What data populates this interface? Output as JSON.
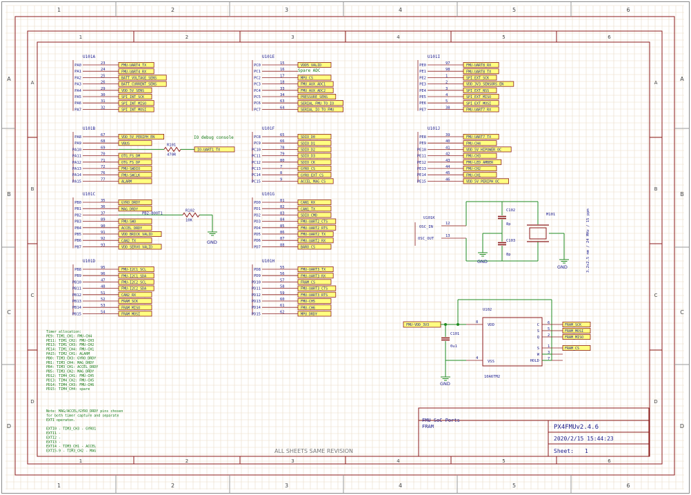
{
  "colors": {
    "border": "#8b1a1a",
    "grid": "#e9dcc6",
    "wire": "#1f8a1f",
    "net_fill": "#ffff80",
    "net_stroke": "#8b1a1a",
    "text_blue": "#1a1a8c",
    "note_green": "#117711"
  },
  "outer_col_labels": [
    "1",
    "2",
    "3",
    "4",
    "5",
    "6"
  ],
  "outer_row_labels": [
    "A",
    "B",
    "C",
    "D"
  ],
  "inner_col_labels": [
    "1",
    "2",
    "3",
    "4",
    "5",
    "6"
  ],
  "inner_row_labels": [
    "A",
    "B",
    "C",
    "D"
  ],
  "blocks": [
    {
      "id": "U101A",
      "pins": [
        {
          "name": "PA0",
          "num": "23",
          "net": "FMU-UART4_TX"
        },
        {
          "name": "PA1",
          "num": "24",
          "net": "FMU-UART4_RX"
        },
        {
          "name": "PA2",
          "num": "25",
          "net": "BATT_VOLTAGE_SENS"
        },
        {
          "name": "PA3",
          "num": "26",
          "net": "BATT_CURRENT_SENS"
        },
        {
          "name": "PA4",
          "num": "29",
          "net": "VDD_5V_SENS"
        },
        {
          "name": "PA5",
          "num": "30",
          "net": "SPI_INT_SCK"
        },
        {
          "name": "PA6",
          "num": "31",
          "net": "SPI_INT_MISO"
        },
        {
          "name": "PA7",
          "num": "32",
          "net": "SPI_INT_MOSI"
        }
      ]
    },
    {
      "id": "U101B",
      "pins": [
        {
          "name": "PA8",
          "num": "67",
          "net": "VDD_5V_PERIPH_EN"
        },
        {
          "name": "PA9",
          "num": "68",
          "net": "VBUS"
        },
        {
          "name": "PA10",
          "num": "69",
          "net": ""
        },
        {
          "name": "PA11",
          "num": "70",
          "net": "OTG_FS_DM"
        },
        {
          "name": "PA12",
          "num": "71",
          "net": "OTG_FS_DP"
        },
        {
          "name": "PA13",
          "num": "72",
          "net": "FMU-SWDIO"
        },
        {
          "name": "PA14",
          "num": "76",
          "net": "FMU-SWCLK"
        },
        {
          "name": "PA15",
          "num": "77",
          "net": "ALARM"
        }
      ]
    },
    {
      "id": "U101C",
      "pins": [
        {
          "name": "PB0",
          "num": "35",
          "net": "GYRO_DRDY"
        },
        {
          "name": "PB1",
          "num": "36",
          "net": "MAG_DRDY"
        },
        {
          "name": "PB2",
          "num": "37",
          "net": ""
        },
        {
          "name": "PB3",
          "num": "89",
          "net": "FMU-SWO"
        },
        {
          "name": "PB4",
          "num": "90",
          "net": "ACCEL_DRDY"
        },
        {
          "name": "PB5",
          "num": "91",
          "net": "VDD_BRICK_VALID"
        },
        {
          "name": "PB6",
          "num": "92",
          "net": "CAN2_TX"
        },
        {
          "name": "PB7",
          "num": "93",
          "net": "VDD_SERVO_VALID"
        }
      ]
    },
    {
      "id": "U101D",
      "pins": [
        {
          "name": "PB8",
          "num": "95",
          "net": "FMU-I2C1_SCL"
        },
        {
          "name": "PB9",
          "num": "96",
          "net": "FMU-I2C1_SDA"
        },
        {
          "name": "PB10",
          "num": "47",
          "net": "FMU-I2C2_SCL"
        },
        {
          "name": "PB11",
          "num": "48",
          "net": "FMU-I2C2_SDA"
        },
        {
          "name": "PB12",
          "num": "51",
          "net": "CAN2_RX"
        },
        {
          "name": "PB13",
          "num": "52",
          "net": "FRAM_SCK"
        },
        {
          "name": "PB14",
          "num": "53",
          "net": "FRAM_MISO"
        },
        {
          "name": "PB15",
          "num": "54",
          "net": "FRAM_MOSI"
        }
      ]
    },
    {
      "id": "U101E",
      "pins": [
        {
          "name": "PC0",
          "num": "15",
          "net": "VDD5_VALID"
        },
        {
          "name": "PC1",
          "num": "16",
          "net": ""
        },
        {
          "name": "PC2",
          "num": "17",
          "net": "MPU_CS"
        },
        {
          "name": "PC3",
          "num": "18",
          "net": "FMU_AUX_ADC1"
        },
        {
          "name": "PC4",
          "num": "33",
          "net": "FMU_AUX_ADC2"
        },
        {
          "name": "PC5",
          "num": "34",
          "net": "PRESSURE_SENS"
        },
        {
          "name": "PC6",
          "num": "63",
          "net": "SERIAL_FMU_TO_IO"
        },
        {
          "name": "PC7",
          "num": "64",
          "net": "SERIAL_IO_TO_FMU"
        }
      ]
    },
    {
      "id": "U101F",
      "pins": [
        {
          "name": "PC8",
          "num": "65",
          "net": "SDIO_D0"
        },
        {
          "name": "PC9",
          "num": "66",
          "net": "SDIO_D1"
        },
        {
          "name": "PC10",
          "num": "78",
          "net": "SDIO_D2"
        },
        {
          "name": "PC11",
          "num": "79",
          "net": "SDIO_D3"
        },
        {
          "name": "PC12",
          "num": "80",
          "net": "SDIO_CK"
        },
        {
          "name": "PC13",
          "num": "7",
          "net": "GYRO_CS"
        },
        {
          "name": "PC14",
          "num": "8",
          "net": "GYRO_EXT_CS"
        },
        {
          "name": "PC15",
          "num": "9",
          "net": "ACCEL_MAG_CS"
        }
      ]
    },
    {
      "id": "U101G",
      "pins": [
        {
          "name": "PD0",
          "num": "81",
          "net": "CAN1_RX"
        },
        {
          "name": "PD1",
          "num": "82",
          "net": "CAN1_TX"
        },
        {
          "name": "PD2",
          "num": "83",
          "net": "SDIO_CMD"
        },
        {
          "name": "PD3",
          "num": "84",
          "net": "FMU-UART2_CTS"
        },
        {
          "name": "PD4",
          "num": "85",
          "net": "FMU-UART2_RTS"
        },
        {
          "name": "PD5",
          "num": "86",
          "net": "FMU-UART2_TX"
        },
        {
          "name": "PD6",
          "num": "87",
          "net": "FMU-UART2_RX"
        },
        {
          "name": "PD7",
          "num": "88",
          "net": "BARO_CS"
        }
      ]
    },
    {
      "id": "U101H",
      "pins": [
        {
          "name": "PD8",
          "num": "55",
          "net": "FMU-UART3_TX"
        },
        {
          "name": "PD9",
          "num": "56",
          "net": "FMU-UART3_RX"
        },
        {
          "name": "PD10",
          "num": "57",
          "net": "FRAM_CS"
        },
        {
          "name": "PD11",
          "num": "58",
          "net": "FMU-UART3_CTS"
        },
        {
          "name": "PD12",
          "num": "59",
          "net": "FMU-UART3_RTS"
        },
        {
          "name": "PD13",
          "num": "60",
          "net": "FMU-CH5"
        },
        {
          "name": "PD14",
          "num": "61",
          "net": "FMU-CH6"
        },
        {
          "name": "PD15",
          "num": "62",
          "net": "MPU_DRDY"
        }
      ]
    },
    {
      "id": "U101I",
      "pins": [
        {
          "name": "PE0",
          "num": "97",
          "net": "FMU-UART8_RX"
        },
        {
          "name": "PE1",
          "num": "98",
          "net": "FMU-UART8_TX"
        },
        {
          "name": "PE2",
          "num": "1",
          "net": "SPI_EXT_SCK"
        },
        {
          "name": "PE3",
          "num": "2",
          "net": "VDD_3V3_SENSORS_EN"
        },
        {
          "name": "PE4",
          "num": "3",
          "net": "SPI_EXT_NSS"
        },
        {
          "name": "PE5",
          "num": "4",
          "net": "SPI_EXT_MISO"
        },
        {
          "name": "PE6",
          "num": "5",
          "net": "SPI_EXT_MOSI"
        },
        {
          "name": "PE7",
          "num": "38",
          "net": "FMU-UART7_RX"
        }
      ]
    },
    {
      "id": "U101J",
      "pins": [
        {
          "name": "PE8",
          "num": "39",
          "net": "FMU-UART7_TX"
        },
        {
          "name": "PE9",
          "num": "40",
          "net": "FMU-CH4"
        },
        {
          "name": "PE10",
          "num": "41",
          "net": "VDD_5V_HIPOWER_OC"
        },
        {
          "name": "PE11",
          "num": "42",
          "net": "FMU-CH3"
        },
        {
          "name": "PE12",
          "num": "43",
          "net": "FMU-LED_AMBER"
        },
        {
          "name": "PE13",
          "num": "44",
          "net": "FMU-CH2"
        },
        {
          "name": "PE14",
          "num": "45",
          "net": "FMU-CH1"
        },
        {
          "name": "PE15",
          "num": "46",
          "net": "VDD_5V_PERIPH_OC"
        }
      ]
    }
  ],
  "io_debug": {
    "title": "IO debug console",
    "net": "IO-UART1_TX",
    "resistor": "R101",
    "value": "470R"
  },
  "boot": {
    "net": "PB2-BOOT1",
    "resistor": "R102",
    "value": "10K",
    "gnd": "GND"
  },
  "spare_adc": "Spare ADC",
  "osc": {
    "id": "U101K",
    "pin_in": "OSC_IN",
    "pin_in_num": "12",
    "pin_out": "OSC_OUT",
    "pin_out_num": "13",
    "c1": "C102",
    "c1_val": "8p",
    "c2": "C103",
    "c2_val": "8p",
    "crystal": "M101",
    "crystal_desc": "3.2x2.5 mm / 24 MHz / 15 ppm",
    "gnd": "GND"
  },
  "fram": {
    "id": "U102",
    "part": "10A6TM2",
    "vdd_net": "FMU-VDD_3V3",
    "vdd_pin": "VDD",
    "vss_pin": "VSS",
    "vdd_num": "8",
    "vss_num": "4",
    "cap": "C101",
    "cap_val": "0u1",
    "gnd": "GND",
    "right_pins": [
      {
        "label": "C",
        "num": "6",
        "net": "FRAM_SCK"
      },
      {
        "label": "S",
        "num": "5",
        "net": "FRAM_MOSI"
      },
      {
        "label": "Q",
        "num": "2",
        "net": "FRAM_MISO"
      },
      {
        "label": "S",
        "num": "1",
        "net": "FRAM_CS"
      },
      {
        "label": "W",
        "num": "3",
        "net": ""
      },
      {
        "label": "HOLD",
        "num": "7",
        "net": ""
      }
    ]
  },
  "timer_notes": [
    "Timer allocation:",
    "PE9: TIM1_CH1: FMU-CH4",
    "PE11: TIM1_CH2: FMU-CH3",
    "PE13: TIM1_CH3: FMU-CH2",
    "PE14: TIM1_CH4: FMU-CH1",
    "PA15: TIM2_CH1: ALARM",
    "PB0: TIM3_CH3: GYRO_DRDY",
    "PB1: TIM3_CH4: MAG_DRDY",
    "PB4: TIM3_CH1: ACCEL_DRDY",
    "PB5: TIM3_CH2: MAG_DRDY",
    "PD12: TIM4_CH1: FMU-CH5",
    "PD13: TIM4_CH2: FMU-CH5",
    "PD14: TIM4_CH3: FMU-CH6",
    "PD15: TIM4_CH4: spare"
  ],
  "exti_notes": [
    "Note: MAG/ACCEL/GYRO_DRDY pins chosen",
    "for both timer capture and separate",
    "EXTI operaton.",
    "",
    "EXTI0 - TIM3_CH3 - GYRO1",
    "EXTI1 -",
    "EXTI2 -",
    "EXTI3 -",
    "EXTI4 - TIM3_CH1 - ACCEL",
    "EXTI5-9 - TIM3_CH2 - MAG"
  ],
  "title_block": {
    "sheet_title": "FMU SoC Ports",
    "sheet_sub": "FRAM",
    "project": "PX4FMUv2.4.6",
    "date": "2020/2/15 15:44:23",
    "sheet_label": "Sheet:",
    "sheet_num": "1"
  },
  "footer": "ALL SHEETS SAME REVISION"
}
